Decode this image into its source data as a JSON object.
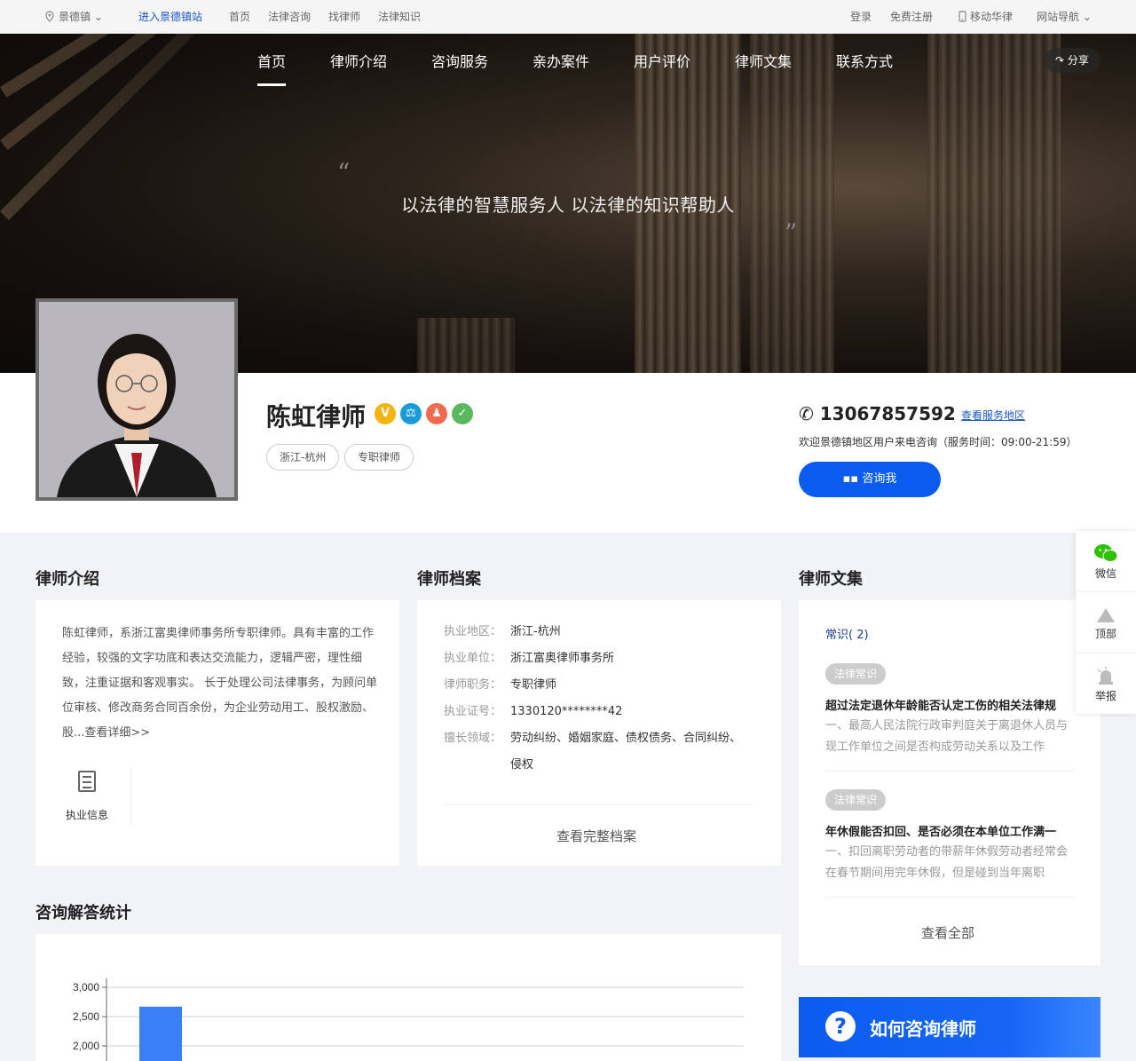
{
  "topbar": {
    "location": "景德镇",
    "enter_site": "进入景德镇站",
    "links": [
      "首页",
      "法律咨询",
      "找律师",
      "法律知识"
    ],
    "login": "登录",
    "register": "免费注册",
    "mobile": "移动华律",
    "site_nav": "网站导航"
  },
  "nav": {
    "items": [
      "首页",
      "律师介绍",
      "咨询服务",
      "亲办案件",
      "用户评价",
      "律师文集",
      "联系方式"
    ],
    "share": "分享"
  },
  "banner": {
    "slogan": "以法律的智慧服务人 以法律的知识帮助人"
  },
  "profile": {
    "name": "陈虹律师",
    "tags": [
      "浙江-杭州",
      "专职律师"
    ],
    "badges": [
      {
        "icon": "verified-icon",
        "color": "#f3b410",
        "glyph": "V"
      },
      {
        "icon": "scales-icon",
        "color": "#1b9bd8",
        "glyph": "⚖"
      },
      {
        "icon": "person-icon",
        "color": "#f06b4d",
        "glyph": "♟"
      },
      {
        "icon": "certificate-icon",
        "color": "#5cb85c",
        "glyph": "✓"
      }
    ],
    "phone": "13067857592",
    "service_area_link": "查看服务地区",
    "welcome": "欢迎景德镇地区用户来电咨询（服务时间：09:00-21:59）",
    "consult_button": "咨询我"
  },
  "intro": {
    "title": "律师介绍",
    "text": "陈虹律师，系浙江富奥律师事务所专职律师。具有丰富的工作经验，较强的文字功底和表达交流能力，逻辑严密，理性细致，注重证据和客观事实。 长于处理公司法律事务，为顾问单位审核、修改商务合同百余份，为企业劳动用工、股权激励、股...查看详细>>",
    "practice_info": "执业信息"
  },
  "archive": {
    "title": "律师档案",
    "rows": [
      {
        "k": "执业地区：",
        "v": "浙江-杭州"
      },
      {
        "k": "执业单位：",
        "v": "浙江富奥律师事务所"
      },
      {
        "k": "律师职务：",
        "v": "专职律师"
      },
      {
        "k": "执业证号：",
        "v": "1330120********42"
      }
    ],
    "specialty_label": "擅长领域：",
    "specialty": "劳动纠纷、婚姻家庭、债权债务、合同纠纷、侵权",
    "view_full": "查看完整档案"
  },
  "articles": {
    "title": "律师文集",
    "category": "常识( 2)",
    "items": [
      {
        "tag": "法律常识",
        "title": "超过法定退休年龄能否认定工伤的相关法律规",
        "summary": "一、最高人民法院行政审判庭关于离退休人员与现工作单位之间是否构成劳动关系以及工作"
      },
      {
        "tag": "法律常识",
        "title": "年休假能否扣回、是否必须在本单位工作满一",
        "summary": "一、扣回离职劳动者的带薪年休假劳动者经常会在春节期间用完年休假，但是碰到当年离职"
      }
    ],
    "view_all": "查看全部"
  },
  "side": {
    "wechat": "微信",
    "top": "顶部",
    "report": "举报"
  },
  "how": {
    "label": "如何咨询律师",
    "q": "?"
  },
  "stats": {
    "title": "咨询解答统计"
  },
  "chart_data": {
    "type": "bar",
    "ytick_labels": [
      "2,000",
      "2,500",
      "3,000"
    ],
    "ylim": [
      1900,
      3050
    ],
    "values": [
      2670
    ],
    "bar_color": "#3a7ff5",
    "grid": true
  }
}
